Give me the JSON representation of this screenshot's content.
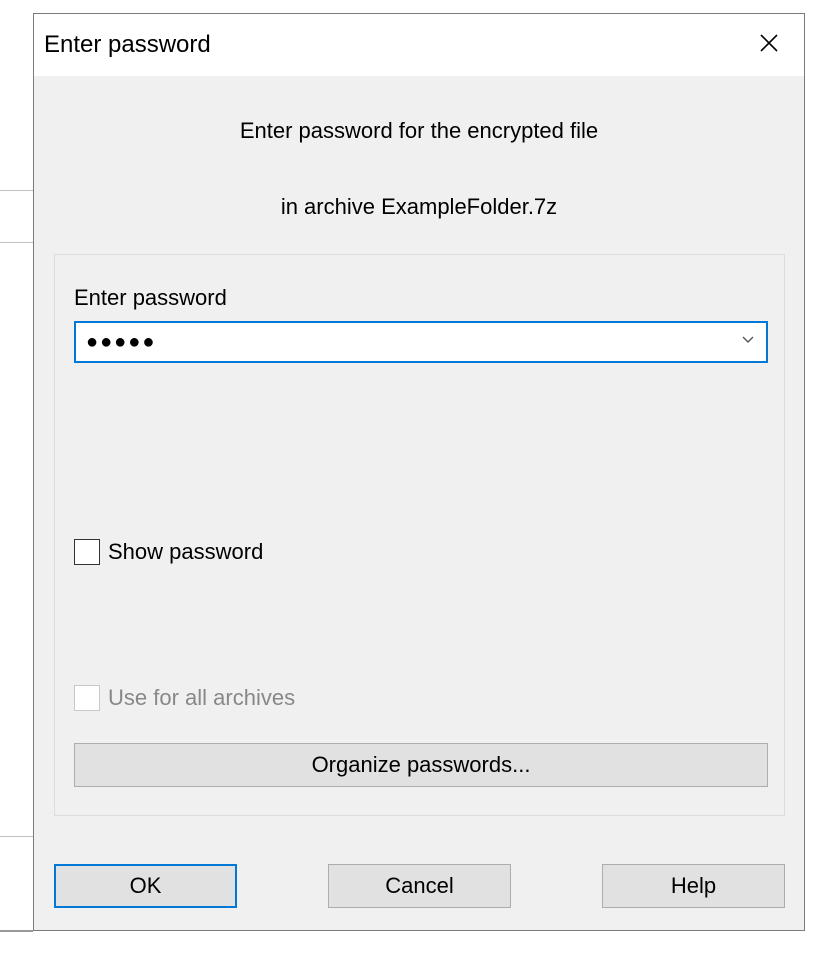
{
  "dialog": {
    "title": "Enter password",
    "prompt_line1": "Enter password for the encrypted file",
    "prompt_line2": "in archive ExampleFolder.7z"
  },
  "form": {
    "password_label": "Enter password",
    "password_value": "●●●●●",
    "show_password_label": "Show password",
    "show_password_checked": false,
    "use_for_all_label": "Use for all archives",
    "use_for_all_enabled": false,
    "organize_label": "Organize passwords..."
  },
  "buttons": {
    "ok": "OK",
    "cancel": "Cancel",
    "help": "Help"
  }
}
